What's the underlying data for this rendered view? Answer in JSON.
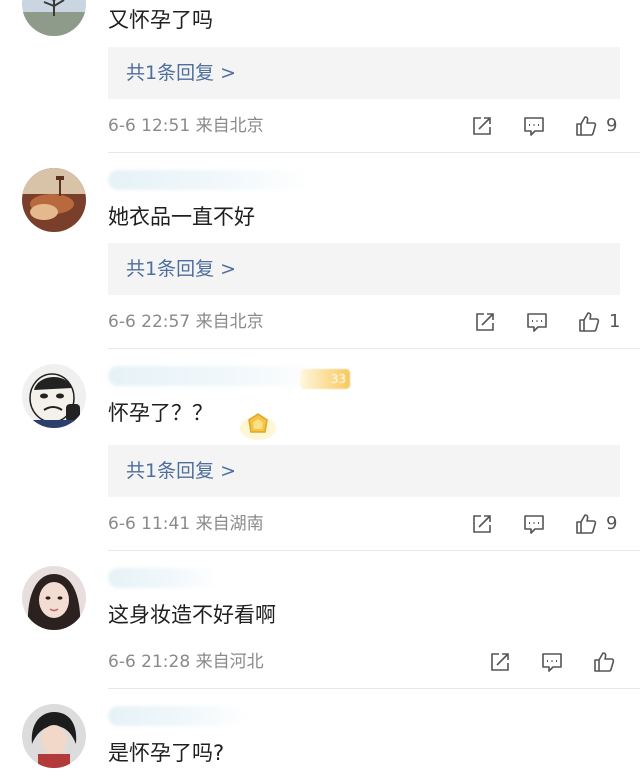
{
  "comments": [
    {
      "text": "又怀孕了吗",
      "reply_label": "共1条回复 >",
      "meta": "6-6 12:51 来自北京",
      "likes": "9"
    },
    {
      "text": "她衣品一直不好",
      "reply_label": "共1条回复 >",
      "meta": "6-6 22:57 来自北京",
      "likes": "1"
    },
    {
      "text": "怀孕了？？",
      "reply_label": "共1条回复 >",
      "meta": "6-6 11:41 来自湖南",
      "likes": "9",
      "badge_text": "33"
    },
    {
      "text": "这身妆造不好看啊",
      "meta": "6-6 21:28 来自河北",
      "likes": ""
    },
    {
      "text": "是怀孕了吗?"
    }
  ],
  "colors": {
    "reply_link": "#4e6e9e",
    "meta_text": "#8a8a8a",
    "reply_bg": "#f4f4f4",
    "divider": "#e8e8e8"
  },
  "icons": {
    "share": "share-icon",
    "comment": "comment-icon",
    "like": "thumbs-up-icon",
    "medal": "medal-icon"
  }
}
